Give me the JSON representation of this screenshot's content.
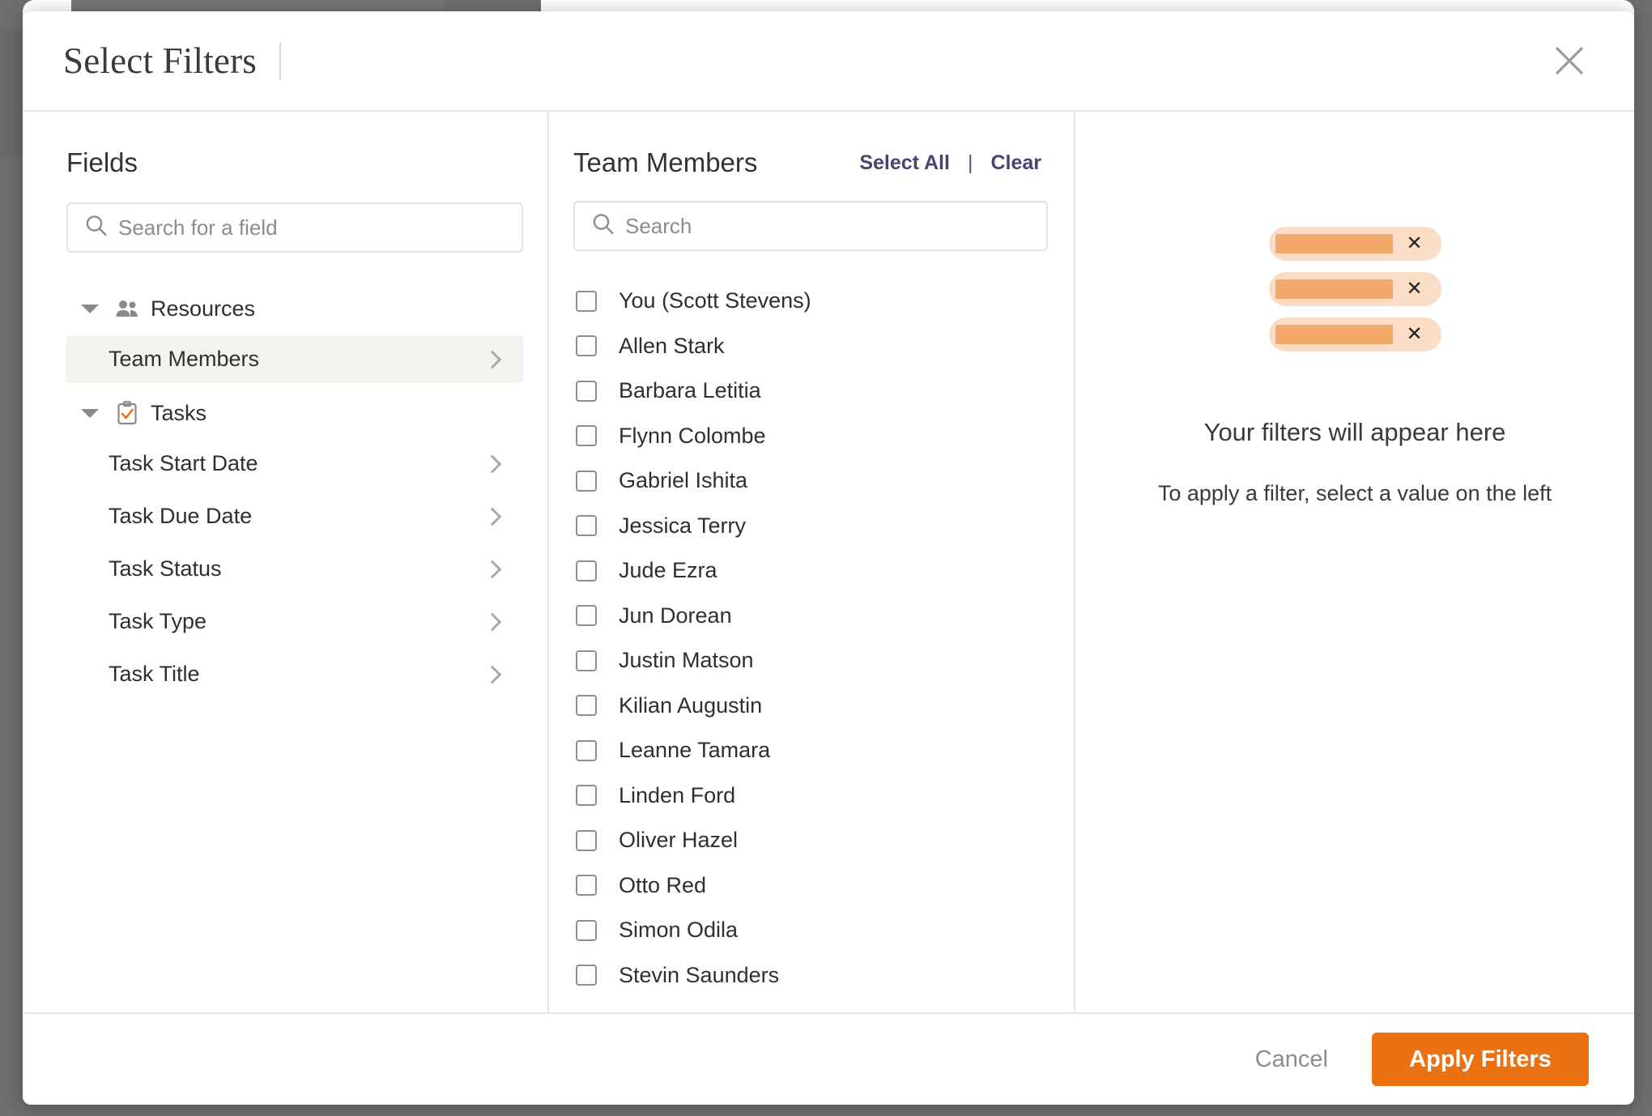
{
  "header": {
    "title": "Select Filters",
    "close_icon": "close-icon"
  },
  "fields_panel": {
    "heading": "Fields",
    "search": {
      "placeholder": "Search for a field",
      "value": "",
      "icon": "search-icon"
    },
    "groups": [
      {
        "label": "Resources",
        "icon": "people-icon",
        "expanded": true,
        "items": [
          {
            "label": "Team Members",
            "selected": true
          }
        ]
      },
      {
        "label": "Tasks",
        "icon": "clipboard-check-icon",
        "expanded": true,
        "items": [
          {
            "label": "Task Start Date",
            "selected": false
          },
          {
            "label": "Task Due Date",
            "selected": false
          },
          {
            "label": "Task Status",
            "selected": false
          },
          {
            "label": "Task Type",
            "selected": false
          },
          {
            "label": "Task Title",
            "selected": false
          }
        ]
      }
    ]
  },
  "values_panel": {
    "title": "Team Members",
    "select_all_label": "Select All",
    "separator": "|",
    "clear_label": "Clear",
    "search": {
      "placeholder": "Search",
      "value": "",
      "icon": "search-icon"
    },
    "options": [
      {
        "label": "You (Scott Stevens)",
        "checked": false
      },
      {
        "label": "Allen Stark",
        "checked": false
      },
      {
        "label": "Barbara Letitia",
        "checked": false
      },
      {
        "label": "Flynn Colombe",
        "checked": false
      },
      {
        "label": "Gabriel Ishita",
        "checked": false
      },
      {
        "label": "Jessica Terry",
        "checked": false
      },
      {
        "label": "Jude Ezra",
        "checked": false
      },
      {
        "label": "Jun Dorean",
        "checked": false
      },
      {
        "label": "Justin Matson",
        "checked": false
      },
      {
        "label": "Kilian Augustin",
        "checked": false
      },
      {
        "label": "Leanne Tamara",
        "checked": false
      },
      {
        "label": "Linden Ford",
        "checked": false
      },
      {
        "label": "Oliver Hazel",
        "checked": false
      },
      {
        "label": "Otto Red",
        "checked": false
      },
      {
        "label": "Simon Odila",
        "checked": false
      },
      {
        "label": "Stevin Saunders",
        "checked": false
      }
    ]
  },
  "preview_panel": {
    "placeholder_pills": [
      {
        "remove_icon": "close-icon"
      },
      {
        "remove_icon": "close-icon"
      },
      {
        "remove_icon": "close-icon"
      }
    ],
    "title": "Your filters will appear here",
    "subtitle": "To apply a filter, select a value on the left"
  },
  "footer": {
    "cancel_label": "Cancel",
    "apply_label": "Apply Filters"
  },
  "colors": {
    "accent_orange": "#ec7211",
    "pill_bg": "#fbdcc6",
    "pill_bar": "#f3a96c",
    "link_purple": "#4a4570",
    "selected_row": "#f4f4ef",
    "backdrop": "#6e6e6e"
  }
}
